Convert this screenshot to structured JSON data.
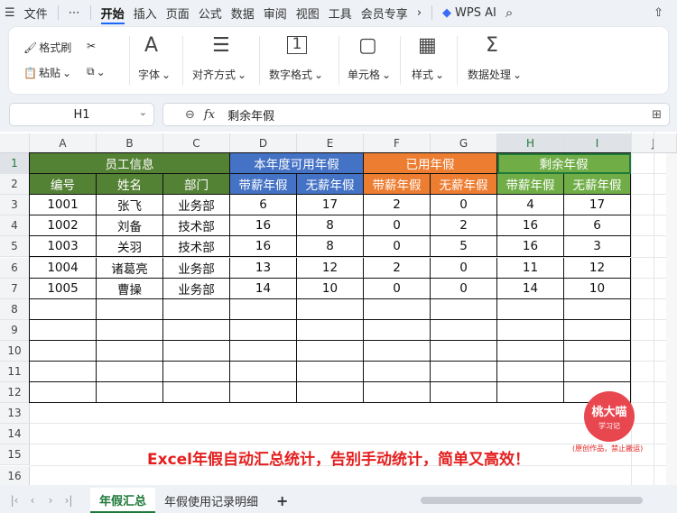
{
  "menubar": {
    "file": "文件",
    "more": "⋯",
    "tabs": [
      "开始",
      "插入",
      "页面",
      "公式",
      "数据",
      "审阅",
      "视图",
      "工具",
      "会员专享"
    ],
    "wps_ai": "WPS AI"
  },
  "ribbon": {
    "format_painter": "格式刷",
    "paste": "粘贴",
    "font": "字体",
    "alignment": "对齐方式",
    "number_format": "数字格式",
    "cell": "单元格",
    "style": "样式",
    "data_processing": "数据处理"
  },
  "formula_bar": {
    "name_box": "H1",
    "fx": "fx",
    "value": "剩余年假"
  },
  "columns": [
    "A",
    "B",
    "C",
    "D",
    "E",
    "F",
    "G",
    "H",
    "I",
    "J"
  ],
  "rows": [
    "1",
    "2",
    "3",
    "4",
    "5",
    "6",
    "7",
    "8",
    "9",
    "10",
    "11",
    "12",
    "13",
    "14",
    "15",
    "16"
  ],
  "table": {
    "group_headers": [
      "员工信息",
      "本年度可用年假",
      "已用年假",
      "剩余年假"
    ],
    "sub_headers": [
      "编号",
      "姓名",
      "部门",
      "带薪年假",
      "无薪年假",
      "带薪年假",
      "无薪年假",
      "带薪年假",
      "无薪年假"
    ],
    "records": [
      [
        "1001",
        "张飞",
        "业务部",
        "6",
        "17",
        "2",
        "0",
        "4",
        "17"
      ],
      [
        "1002",
        "刘备",
        "技术部",
        "16",
        "8",
        "0",
        "2",
        "16",
        "6"
      ],
      [
        "1003",
        "关羽",
        "技术部",
        "16",
        "8",
        "0",
        "5",
        "16",
        "3"
      ],
      [
        "1004",
        "诸葛亮",
        "业务部",
        "13",
        "12",
        "2",
        "0",
        "11",
        "12"
      ],
      [
        "1005",
        "曹操",
        "业务部",
        "14",
        "10",
        "0",
        "0",
        "14",
        "10"
      ]
    ]
  },
  "caption": "Excel年假自动汇总统计，告别手动统计，简单又高效！",
  "badge": {
    "title": "桃大喵",
    "subtitle": "学习记",
    "note": "(原创作品，禁止搬运)"
  },
  "sheet_tabs": [
    "年假汇总",
    "年假使用记录明细"
  ],
  "add_sheet": "+",
  "colors": {
    "employee": "#548235",
    "available": "#4472c4",
    "used": "#ed7d31",
    "remaining": "#70ad47",
    "accent": "#1f7a3a"
  }
}
